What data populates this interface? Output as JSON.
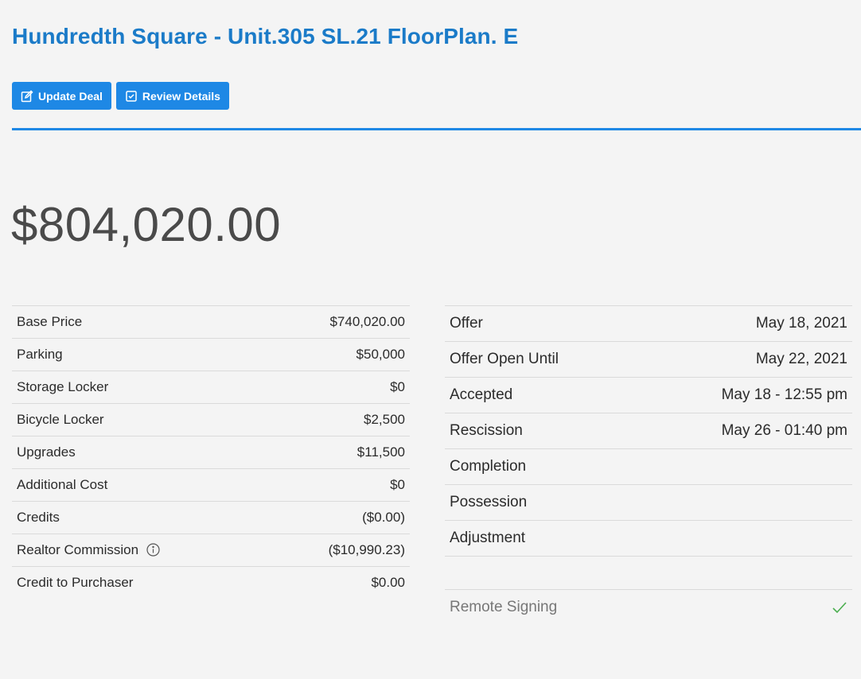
{
  "header": {
    "title": "Hundredth Square - Unit.305 SL.21 FloorPlan. E"
  },
  "actions": {
    "update_label": "Update Deal",
    "review_label": "Review Details"
  },
  "summary": {
    "total_price": "$804,020.00"
  },
  "pricing": [
    {
      "label": "Base Price",
      "value": "$740,020.00"
    },
    {
      "label": "Parking",
      "value": "$50,000"
    },
    {
      "label": "Storage Locker",
      "value": "$0"
    },
    {
      "label": "Bicycle Locker",
      "value": "$2,500"
    },
    {
      "label": "Upgrades",
      "value": "$11,500"
    },
    {
      "label": "Additional Cost",
      "value": "$0"
    },
    {
      "label": "Credits",
      "value": "($0.00)"
    },
    {
      "label": "Realtor Commission",
      "value": "($10,990.23)"
    },
    {
      "label": "Credit to Purchaser",
      "value": "$0.00"
    }
  ],
  "dates": [
    {
      "label": "Offer",
      "value": "May 18, 2021"
    },
    {
      "label": "Offer Open Until",
      "value": "May 22, 2021"
    },
    {
      "label": "Accepted",
      "value": "May 18 - 12:55 pm"
    },
    {
      "label": "Rescission",
      "value": "May 26 - 01:40 pm"
    },
    {
      "label": "Completion",
      "value": ""
    },
    {
      "label": "Possession",
      "value": ""
    },
    {
      "label": "Adjustment",
      "value": ""
    }
  ],
  "remote_signing": {
    "label": "Remote Signing",
    "status_icon": "check-icon"
  },
  "colors": {
    "accent": "#1e88e5",
    "title": "#1b7bc8",
    "check": "#4caf50"
  }
}
